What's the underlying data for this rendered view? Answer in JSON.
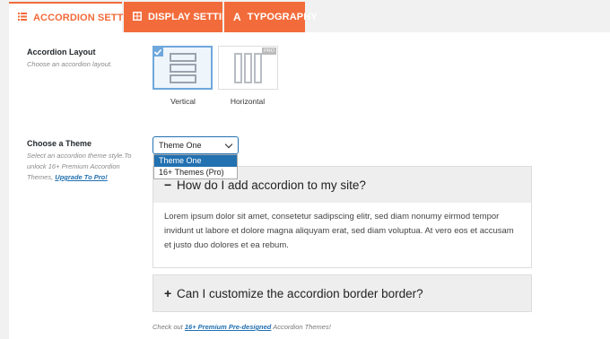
{
  "tabs": [
    {
      "label": "ACCORDION SETTINGS",
      "icon": "list-icon",
      "active": true
    },
    {
      "label": "DISPLAY SETTINGS",
      "icon": "display-icon",
      "active": false
    },
    {
      "label": "TYPOGRAPHY",
      "icon": "typography-icon",
      "active": false
    }
  ],
  "layout": {
    "label": "Accordion Layout",
    "description": "Choose an accordion layout.",
    "options": [
      {
        "label": "Vertical",
        "selected": true
      },
      {
        "label": "Horizontal",
        "selected": false,
        "badge": "PRO"
      }
    ]
  },
  "theme": {
    "label": "Choose a Theme",
    "description": "Select an accordion theme style.To unlock 16+ Premium Accordion Themes,",
    "upgrade_link": "Upgrade To Pro!",
    "selected": "Theme One",
    "options": [
      "Theme One",
      "16+ Themes (Pro)"
    ]
  },
  "accordion": [
    {
      "sign": "−",
      "title": "How do I add accordion to my site?",
      "expanded": true,
      "body": "Lorem ipsum dolor sit amet, consetetur sadipscing elitr, sed diam nonumy eirmod tempor invidunt ut labore et dolore magna aliquyam erat, sed diam voluptua. At vero eos et accusam et justo duo dolores et ea rebum."
    },
    {
      "sign": "+",
      "title": "Can I customize the accordion border border?",
      "expanded": false
    }
  ],
  "footnote": {
    "prefix": "Check out",
    "link": "16+ Premium Pre-designed",
    "suffix": "Accordion Themes!"
  },
  "colors": {
    "accent": "#f26b3a",
    "link": "#2271b1",
    "selected_border": "#6fa8dc"
  }
}
